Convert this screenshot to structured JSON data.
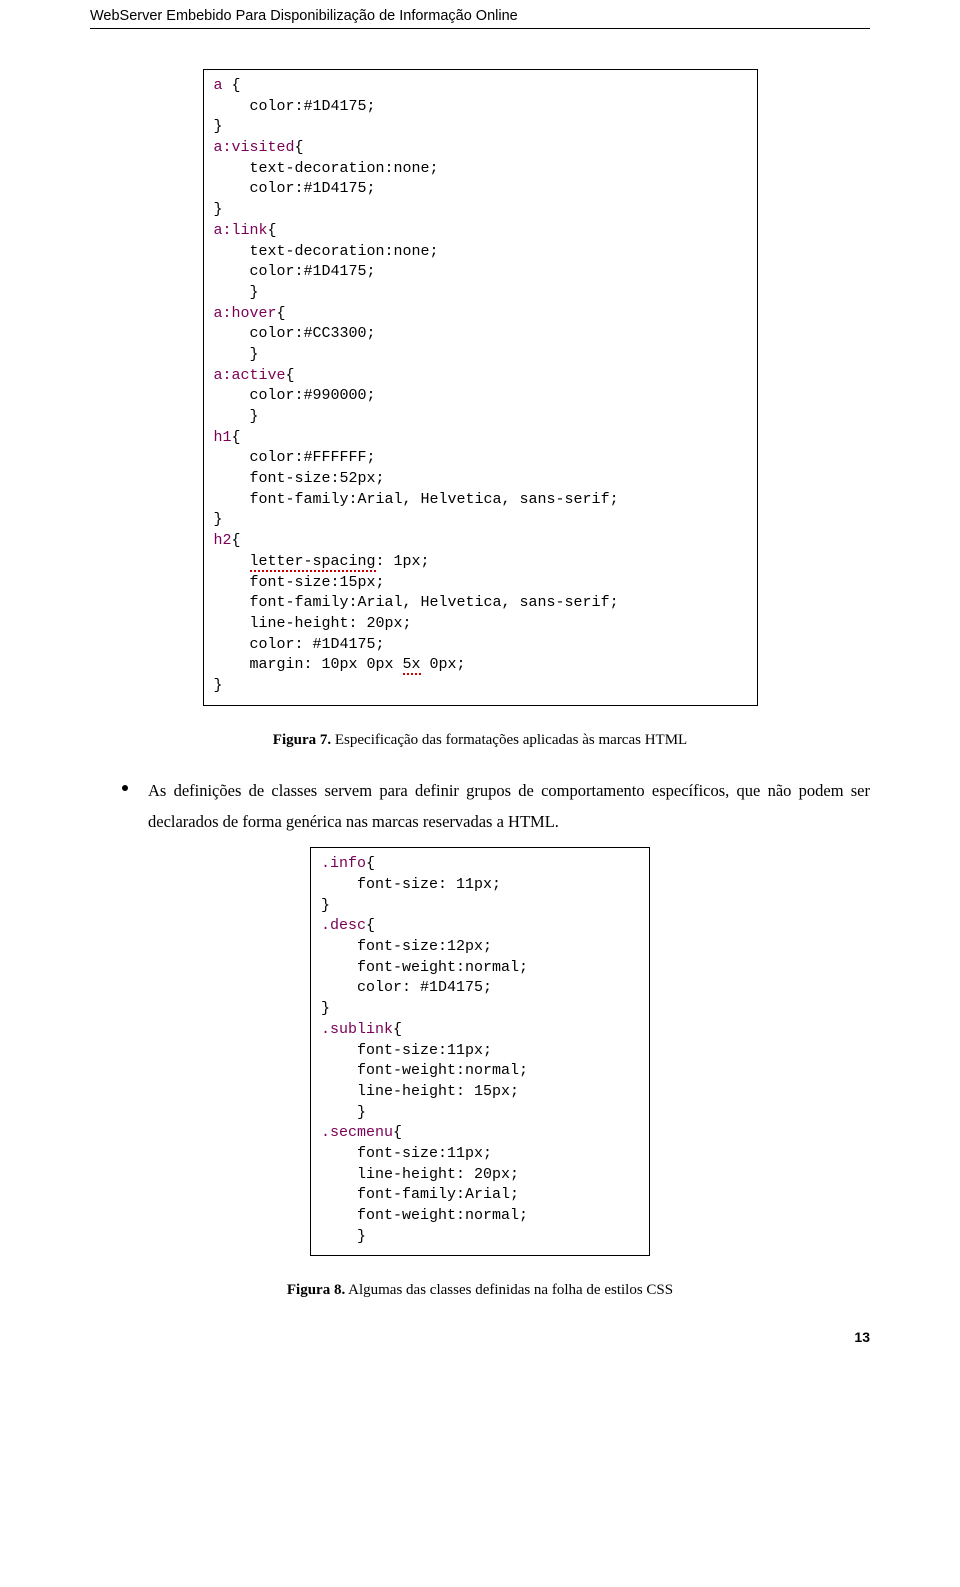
{
  "header": "WebServer Embebido Para Disponibilização de Informação Online",
  "code1": {
    "lines": [
      [
        [
          "sel",
          "a"
        ],
        [
          "txt",
          " {"
        ]
      ],
      [
        [
          "txt",
          "    color:#1D4175;"
        ]
      ],
      [
        [
          "txt",
          "}"
        ]
      ],
      [
        [
          "sel",
          "a:visited"
        ],
        [
          "txt",
          "{"
        ]
      ],
      [
        [
          "txt",
          "    text-decoration:none;"
        ]
      ],
      [
        [
          "txt",
          "    color:#1D4175;"
        ]
      ],
      [
        [
          "txt",
          "}"
        ]
      ],
      [
        [
          "sel",
          "a:link"
        ],
        [
          "txt",
          "{"
        ]
      ],
      [
        [
          "txt",
          "    text-decoration:none;"
        ]
      ],
      [
        [
          "txt",
          "    color:#1D4175;"
        ]
      ],
      [
        [
          "txt",
          "    }"
        ]
      ],
      [
        [
          "sel",
          "a:hover"
        ],
        [
          "txt",
          "{"
        ]
      ],
      [
        [
          "txt",
          "    color:#CC3300;"
        ]
      ],
      [
        [
          "txt",
          "    }"
        ]
      ],
      [
        [
          "sel",
          "a:active"
        ],
        [
          "txt",
          "{"
        ]
      ],
      [
        [
          "txt",
          "    color:#990000;"
        ]
      ],
      [
        [
          "txt",
          "    }"
        ]
      ],
      [
        [
          "sel",
          "h1"
        ],
        [
          "txt",
          "{"
        ]
      ],
      [
        [
          "txt",
          "    color:#FFFFFF;"
        ]
      ],
      [
        [
          "txt",
          "    font-size:52px;"
        ]
      ],
      [
        [
          "txt",
          "    font-family:Arial, Helvetica, sans-serif;"
        ]
      ],
      [
        [
          "txt",
          "}"
        ]
      ],
      [
        [
          "sel",
          "h2"
        ],
        [
          "txt",
          "{"
        ]
      ],
      [
        [
          "txt",
          "    "
        ],
        [
          "err",
          "letter-spacing"
        ],
        [
          "txt",
          ": 1px;"
        ]
      ],
      [
        [
          "txt",
          "    font-size:15px;"
        ]
      ],
      [
        [
          "txt",
          "    font-family:Arial, Helvetica, sans-serif;"
        ]
      ],
      [
        [
          "txt",
          "    line-height: 20px;"
        ]
      ],
      [
        [
          "txt",
          "    color: #1D4175;"
        ]
      ],
      [
        [
          "txt",
          "    margin: 10px 0px "
        ],
        [
          "err",
          "5x"
        ],
        [
          "txt",
          " 0px;"
        ]
      ],
      [
        [
          "txt",
          "}"
        ]
      ]
    ]
  },
  "caption1": {
    "bold": "Figura 7.",
    "rest": " Especificação das formatações aplicadas às marcas HTML"
  },
  "bullet": "As definições de classes servem para definir grupos de comportamento específicos, que não podem ser declarados de forma genérica nas marcas reservadas a HTML.",
  "code2": {
    "lines": [
      [
        [
          "sel",
          ".info"
        ],
        [
          "txt",
          "{"
        ]
      ],
      [
        [
          "txt",
          "    font-size: 11px;"
        ]
      ],
      [
        [
          "txt",
          "}"
        ]
      ],
      [
        [
          "sel",
          ".desc"
        ],
        [
          "txt",
          "{"
        ]
      ],
      [
        [
          "txt",
          "    font-size:12px;"
        ]
      ],
      [
        [
          "txt",
          "    font-weight:normal;"
        ]
      ],
      [
        [
          "txt",
          "    color: #1D4175;"
        ]
      ],
      [
        [
          "txt",
          "}"
        ]
      ],
      [
        [
          "sel",
          ".sublink"
        ],
        [
          "txt",
          "{"
        ]
      ],
      [
        [
          "txt",
          "    font-size:11px;"
        ]
      ],
      [
        [
          "txt",
          "    font-weight:normal;"
        ]
      ],
      [
        [
          "txt",
          "    line-height: 15px;"
        ]
      ],
      [
        [
          "txt",
          "    }"
        ]
      ],
      [
        [
          "sel",
          ".secmenu"
        ],
        [
          "txt",
          "{"
        ]
      ],
      [
        [
          "txt",
          "    font-size:11px;"
        ]
      ],
      [
        [
          "txt",
          "    line-height: 20px;"
        ]
      ],
      [
        [
          "txt",
          "    font-family:Arial;"
        ]
      ],
      [
        [
          "txt",
          "    font-weight:normal;"
        ]
      ],
      [
        [
          "txt",
          "    }"
        ]
      ]
    ]
  },
  "caption2": {
    "bold": "Figura 8.",
    "rest": " Algumas das classes definidas na folha de estilos CSS"
  },
  "pageNumber": "13"
}
